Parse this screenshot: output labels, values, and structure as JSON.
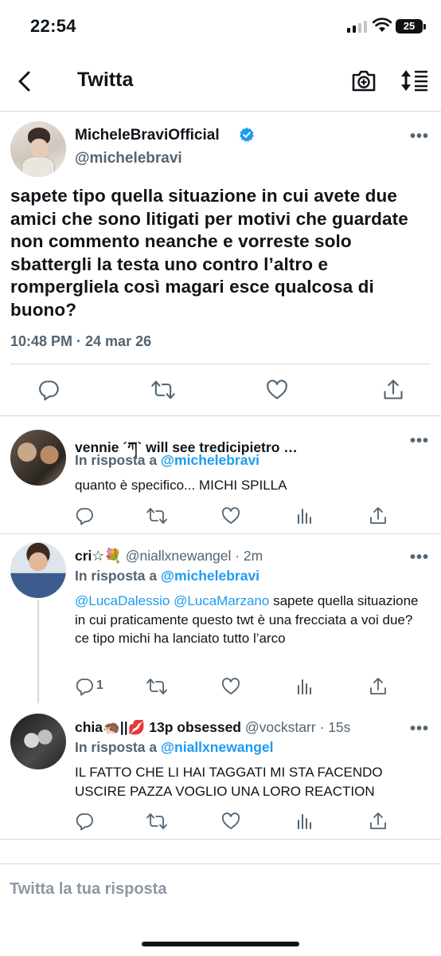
{
  "status_bar": {
    "time": "22:54",
    "battery": "25"
  },
  "header": {
    "title": "Twitta"
  },
  "main_tweet": {
    "display_name": "MicheleBraviOfficial",
    "handle": "@michelebravi",
    "text": "sapete tipo quella situazione in cui avete due amici che sono litigati per motivi che guardate non commento neanche e vorreste solo sbattergli la testa uno contro l’altro e rompergliela così magari esce qualcosa di buono?",
    "timestamp": "10:48 PM · 24 mar 26",
    "more_label": "•••"
  },
  "replies": [
    {
      "display_name": "vennie ´ཀ` will see tredicipietro …",
      "in_reply_prefix": "In risposta a",
      "in_reply_to": "@michelebravi",
      "body": "quanto è specifico... MICHI SPILLA",
      "more_label": "•••"
    },
    {
      "display_name": "cri☆💐",
      "handle_time": "@niallxnewangel · 2m",
      "in_reply_prefix": "In risposta a",
      "in_reply_to": "@michelebravi",
      "mention1": "@LucaDalessio",
      "mention2": "@LucaMarzano",
      "body": "sapete quella situazione in cui praticamente questo twt è una frecciata a voi due? ce tipo michi ha lanciato tutto l’arco",
      "reply_count": "1",
      "more_label": "•••"
    },
    {
      "display_name": "chia🦔||💋 13p obsessed",
      "handle_time": "@vockstarr · 15s",
      "in_reply_prefix": "In risposta a",
      "in_reply_to": "@niallxnewangel",
      "body": "IL FATTO CHE LI HAI TAGGATI MI STA FACENDO USCIRE PAZZA VOGLIO UNA LORO REACTION",
      "more_label": "•••"
    }
  ],
  "compose": {
    "placeholder": "Twitta la tua risposta"
  },
  "colors": {
    "link": "#1d9bf0",
    "secondary": "#536471",
    "verified": "#1d9bf0"
  },
  "icons": [
    "back-arrow-icon",
    "camera-plus-icon",
    "sort-icon",
    "verified-icon",
    "reply-icon",
    "retweet-icon",
    "like-icon",
    "share-icon",
    "analytics-icon"
  ]
}
